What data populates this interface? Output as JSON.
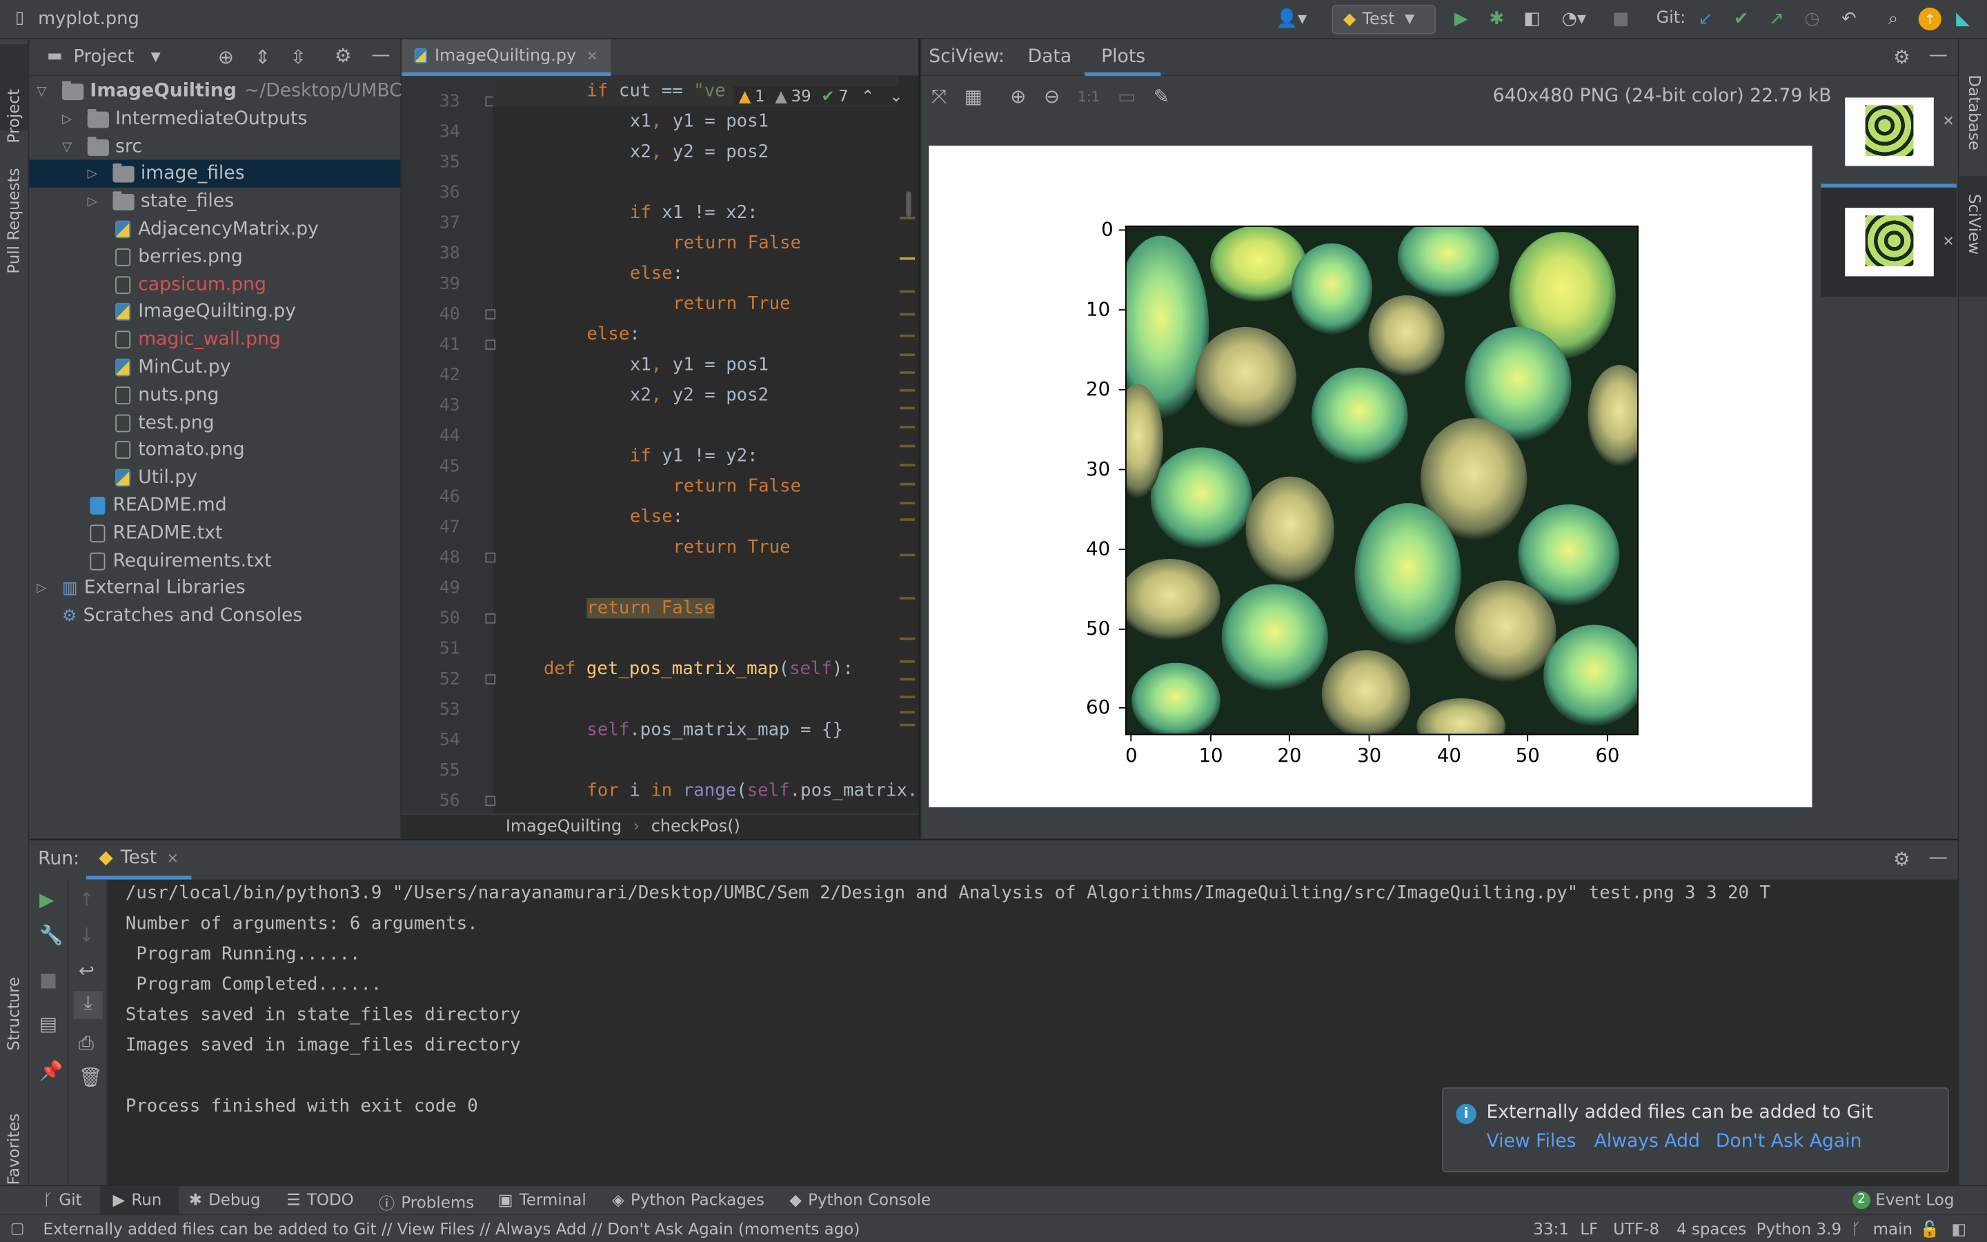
{
  "titlebar": {
    "file": "myplot.png",
    "run_config": "Test",
    "git_label": "Git:"
  },
  "left_tabs": {
    "project": "Project",
    "pull_requests": "Pull Requests",
    "structure": "Structure",
    "favorites": "Favorites"
  },
  "right_tabs": {
    "database": "Database",
    "sciview": "SciView"
  },
  "project": {
    "title": "Project",
    "root": {
      "name": "ImageQuilting",
      "path": "~/Desktop/UMBC/Se"
    },
    "items": [
      {
        "label": "IntermediateOutputs"
      },
      {
        "label": "src"
      },
      {
        "label": "image_files"
      },
      {
        "label": "state_files"
      },
      {
        "label": "AdjacencyMatrix.py"
      },
      {
        "label": "berries.png"
      },
      {
        "label": "capsicum.png"
      },
      {
        "label": "ImageQuilting.py"
      },
      {
        "label": "magic_wall.png"
      },
      {
        "label": "MinCut.py"
      },
      {
        "label": "nuts.png"
      },
      {
        "label": "test.png"
      },
      {
        "label": "tomato.png"
      },
      {
        "label": "Util.py"
      },
      {
        "label": "README.md"
      },
      {
        "label": "README.txt"
      },
      {
        "label": "Requirements.txt"
      },
      {
        "label": "External Libraries"
      },
      {
        "label": "Scratches and Consoles"
      }
    ]
  },
  "editor": {
    "tab": "ImageQuilting.py",
    "inspections": {
      "warnings": "1",
      "weak": "39",
      "ok": "7"
    },
    "line_numbers": [
      "33",
      "34",
      "35",
      "36",
      "37",
      "38",
      "39",
      "40",
      "41",
      "42",
      "43",
      "44",
      "45",
      "46",
      "47",
      "48",
      "49",
      "50",
      "51",
      "52",
      "53",
      "54",
      "55",
      "56"
    ],
    "breadcrumb": {
      "class": "ImageQuilting",
      "method": "checkPos()"
    }
  },
  "sciview": {
    "title": "SciView:",
    "tabs": [
      "Data",
      "Plots"
    ],
    "image_info": "640x480 PNG (24-bit color) 22.79 kB",
    "y_ticks": [
      "0",
      "10",
      "20",
      "30",
      "40",
      "50",
      "60"
    ],
    "x_ticks": [
      "0",
      "10",
      "20",
      "30",
      "40",
      "50",
      "60"
    ]
  },
  "run": {
    "label": "Run:",
    "tab": "Test",
    "output": [
      "/usr/local/bin/python3.9 \"/Users/narayanamurari/Desktop/UMBC/Sem 2/Design and Analysis of Algorithms/ImageQuilting/src/ImageQuilting.py\" test.png 3 3 20 T",
      "Number of arguments: 6 arguments.",
      " Program Running......",
      " Program Completed......",
      "States saved in state_files directory",
      "Images saved in image_files directory",
      "",
      "Process finished with exit code 0"
    ]
  },
  "notification": {
    "message": "Externally added files can be added to Git",
    "actions": [
      "View Files",
      "Always Add",
      "Don't Ask Again"
    ]
  },
  "bottom_tabs": [
    "Git",
    "Run",
    "Debug",
    "TODO",
    "Problems",
    "Terminal",
    "Python Packages",
    "Python Console"
  ],
  "event_log": {
    "count": "2",
    "label": "Event Log"
  },
  "status": {
    "message": "Externally added files can be added to Git // View Files // Always Add // Don't Ask Again (moments ago)",
    "position": "33:1",
    "line_sep": "LF",
    "encoding": "UTF-8",
    "indent": "4 spaces",
    "interpreter": "Python 3.9",
    "branch": "main"
  }
}
